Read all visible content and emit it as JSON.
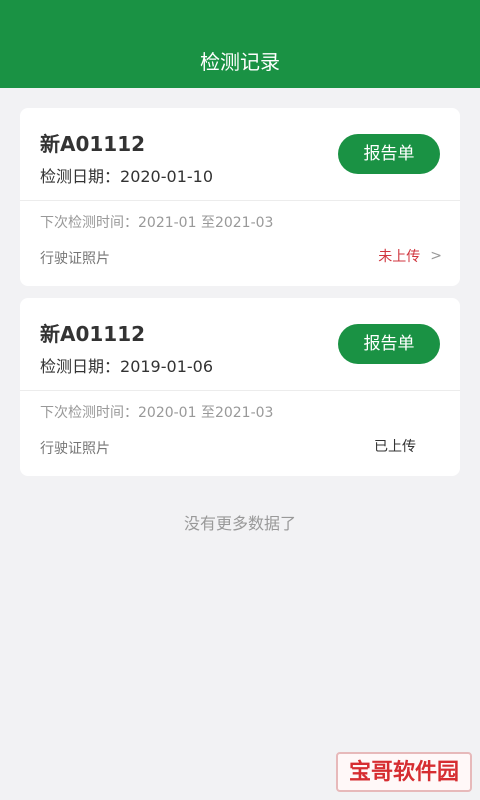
{
  "header": {
    "title": "检测记录"
  },
  "records": [
    {
      "plate": "新A01112",
      "date_label": "检测日期：",
      "date": "2020-01-10",
      "report_label": "报告单",
      "next_label": "下次检测时间：",
      "next_range": "2021-01 至2021-03",
      "license_label": "行驶证照片",
      "upload_status": "未上传",
      "status_color": "#d0363f"
    },
    {
      "plate": "新A01112",
      "date_label": "检测日期：",
      "date": "2019-01-06",
      "report_label": "报告单",
      "next_label": "下次检测时间：",
      "next_range": "2020-01 至2021-03",
      "license_label": "行驶证照片",
      "upload_status": "已上传",
      "status_color": "#333333"
    }
  ],
  "footer": {
    "no_more_text": "没有更多数据了"
  },
  "watermark": {
    "text": "宝哥软件园"
  },
  "theme": {
    "primary": "#1a9244",
    "background": "#f2f2f4"
  }
}
